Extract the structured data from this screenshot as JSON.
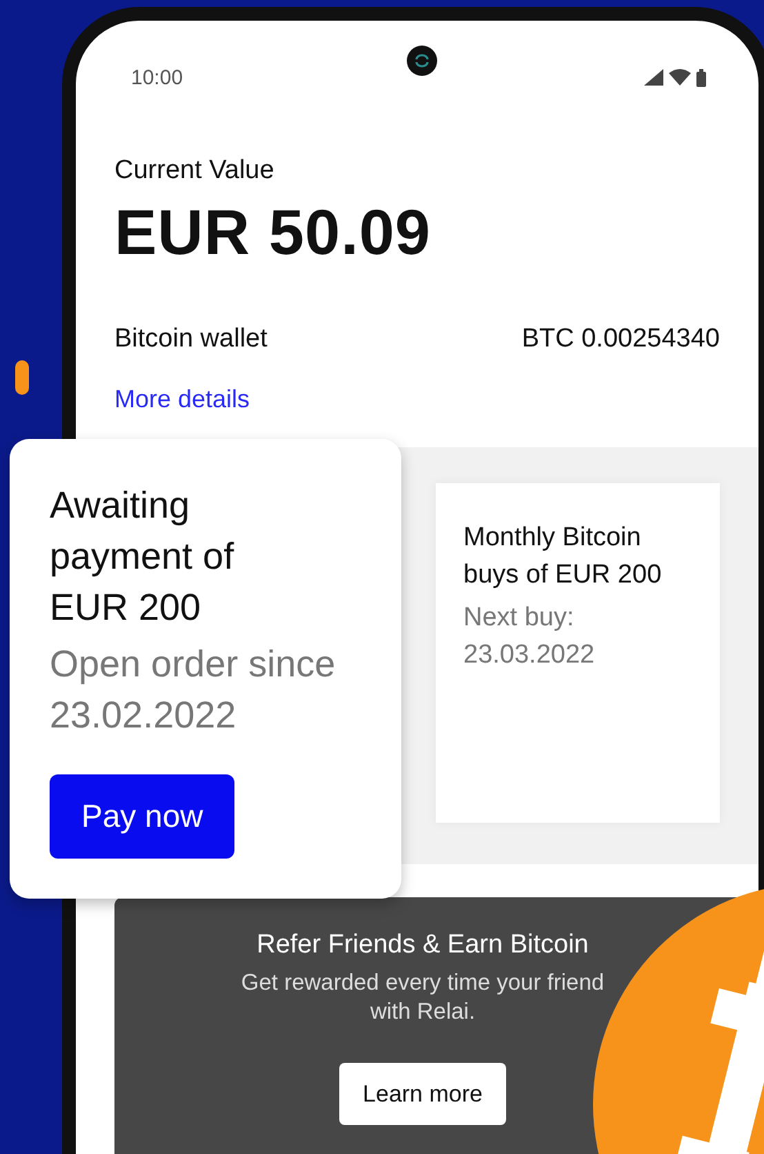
{
  "status_bar": {
    "time": "10:00"
  },
  "balance": {
    "label": "Current Value",
    "amount": "EUR 50.09"
  },
  "wallet": {
    "name": "Bitcoin wallet",
    "amount": "BTC 0.00254340",
    "link": "More details"
  },
  "open_order": {
    "title": "Awaiting payment of EUR 200",
    "subtitle": "Open order since 23.02.2022",
    "button": "Pay now"
  },
  "savings_plan": {
    "title": "Monthly Bitcoin buys of EUR 200",
    "next_buy": "Next buy: 23.03.2022"
  },
  "referral": {
    "title": "Refer Friends & Earn Bitcoin",
    "text_lines": [
      "Get rewarded every time your friend",
      "with Relai."
    ],
    "button": "Learn more"
  }
}
